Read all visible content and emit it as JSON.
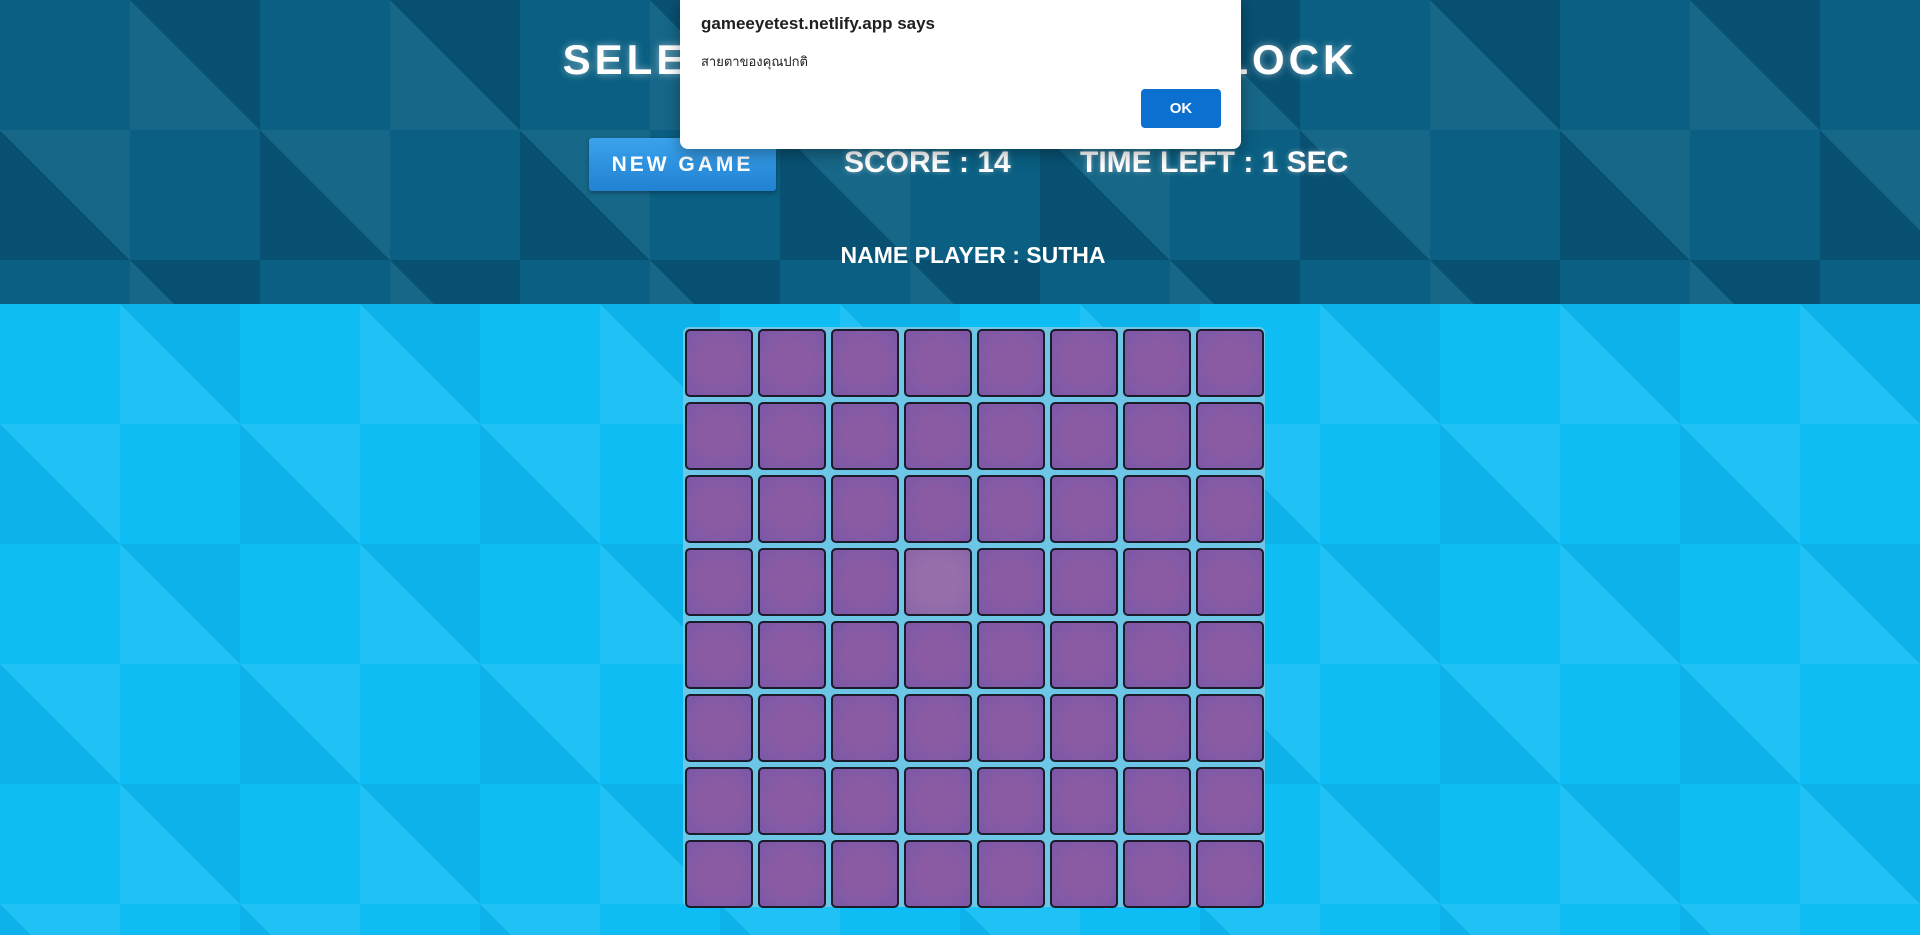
{
  "header": {
    "title": "SELECT THE ODD COLOR BLOCK",
    "new_game_label": "NEW GAME",
    "score_text": "SCORE : 14",
    "time_text": "TIME LEFT : 1 SEC",
    "player_text": "NAME PLAYER : SUTHA"
  },
  "board": {
    "rows": 8,
    "cols": 8,
    "base_color": "#8a5ba2",
    "odd_color": "#976fab",
    "odd_cell": {
      "row": 4,
      "col": 4
    }
  },
  "dialog": {
    "title": "gameeyetest.netlify.app says",
    "message": "สายตาของคุณปกติ",
    "ok_label": "OK"
  }
}
